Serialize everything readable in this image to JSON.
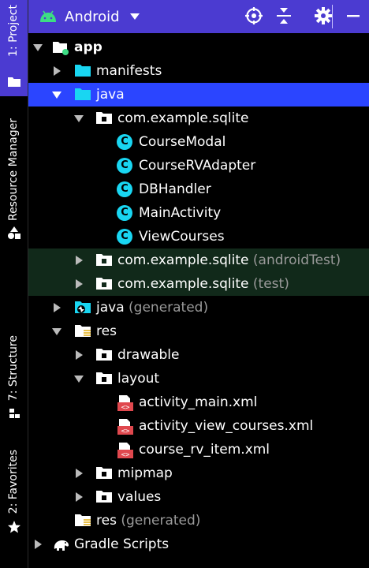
{
  "sidebar": {
    "tabs": [
      {
        "label": "1: Project"
      },
      {
        "label": "Resource Manager"
      },
      {
        "label": "7: Structure"
      },
      {
        "label": "2: Favorites"
      }
    ]
  },
  "toolbar": {
    "view_label": "Android"
  },
  "tree": {
    "app": "app",
    "manifests": "manifests",
    "java": "java",
    "pkg_main": "com.example.sqlite",
    "classes": [
      "CourseModal",
      "CourseRVAdapter",
      "DBHandler",
      "MainActivity",
      "ViewCourses"
    ],
    "class_badge": "C",
    "pkg_android_test": "com.example.sqlite",
    "pkg_android_test_suffix": "(androidTest)",
    "pkg_test": "com.example.sqlite",
    "pkg_test_suffix": "(test)",
    "java_generated": "java",
    "java_generated_suffix": "(generated)",
    "res": "res",
    "drawable": "drawable",
    "layout": "layout",
    "layout_files": [
      "activity_main.xml",
      "activity_view_courses.xml",
      "course_rv_item.xml"
    ],
    "mipmap": "mipmap",
    "values": "values",
    "res_generated": "res",
    "res_generated_suffix": "(generated)",
    "gradle_scripts": "Gradle Scripts"
  },
  "colors": {
    "accent": "#4b3bd1",
    "selection": "#2b45ff",
    "test_row": "#11291a",
    "folder": "#19d6f2",
    "class_badge": "#19d6f2",
    "xml_icon": "#e0484e"
  },
  "icons": {
    "android": "android-icon",
    "locate": "crosshair-icon",
    "collapse": "collapse-all-icon",
    "settings": "gear-icon",
    "hide": "minimize-icon"
  }
}
